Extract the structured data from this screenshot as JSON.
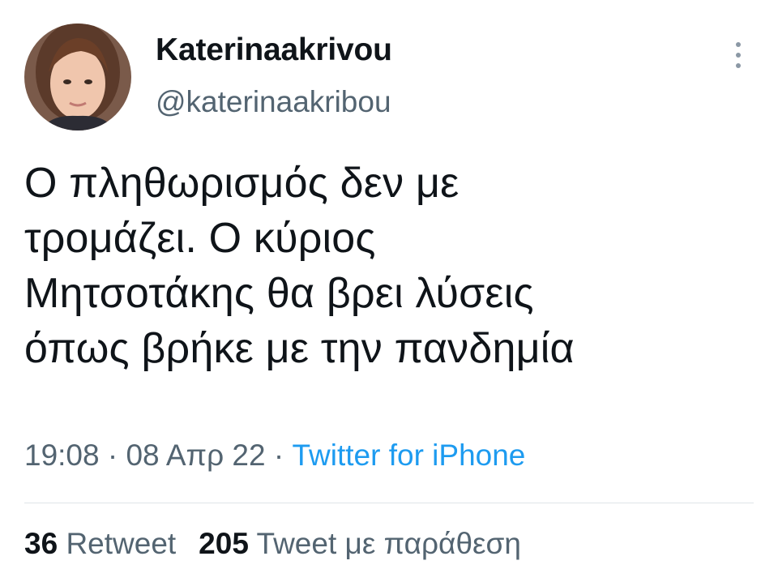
{
  "author": {
    "display_name": "Katerinaakrivou",
    "handle": "@katerinaakribou",
    "avatar_icon": "user-avatar-photo"
  },
  "menu": {
    "icon": "more-vertical-icon"
  },
  "tweet": {
    "text_lines": [
      "Ο πληθωρισμός δεν με",
      "τρομάζει. Ο κύριος",
      "Μητσοτάκης θα βρει λύσεις",
      "όπως βρήκε με την πανδημία"
    ]
  },
  "meta": {
    "time": "19:08",
    "separator1": " · ",
    "date": "08 Απρ 22",
    "separator2": " · ",
    "source": "Twitter for iPhone"
  },
  "stats": {
    "retweets_count": "36",
    "retweets_label": "Retweet",
    "quotes_count": "205",
    "quotes_label": "Tweet με παράθεση"
  },
  "colors": {
    "text_primary": "#0f1419",
    "text_secondary": "#536471",
    "link": "#1d9bf0",
    "divider": "#dfe4e8"
  }
}
